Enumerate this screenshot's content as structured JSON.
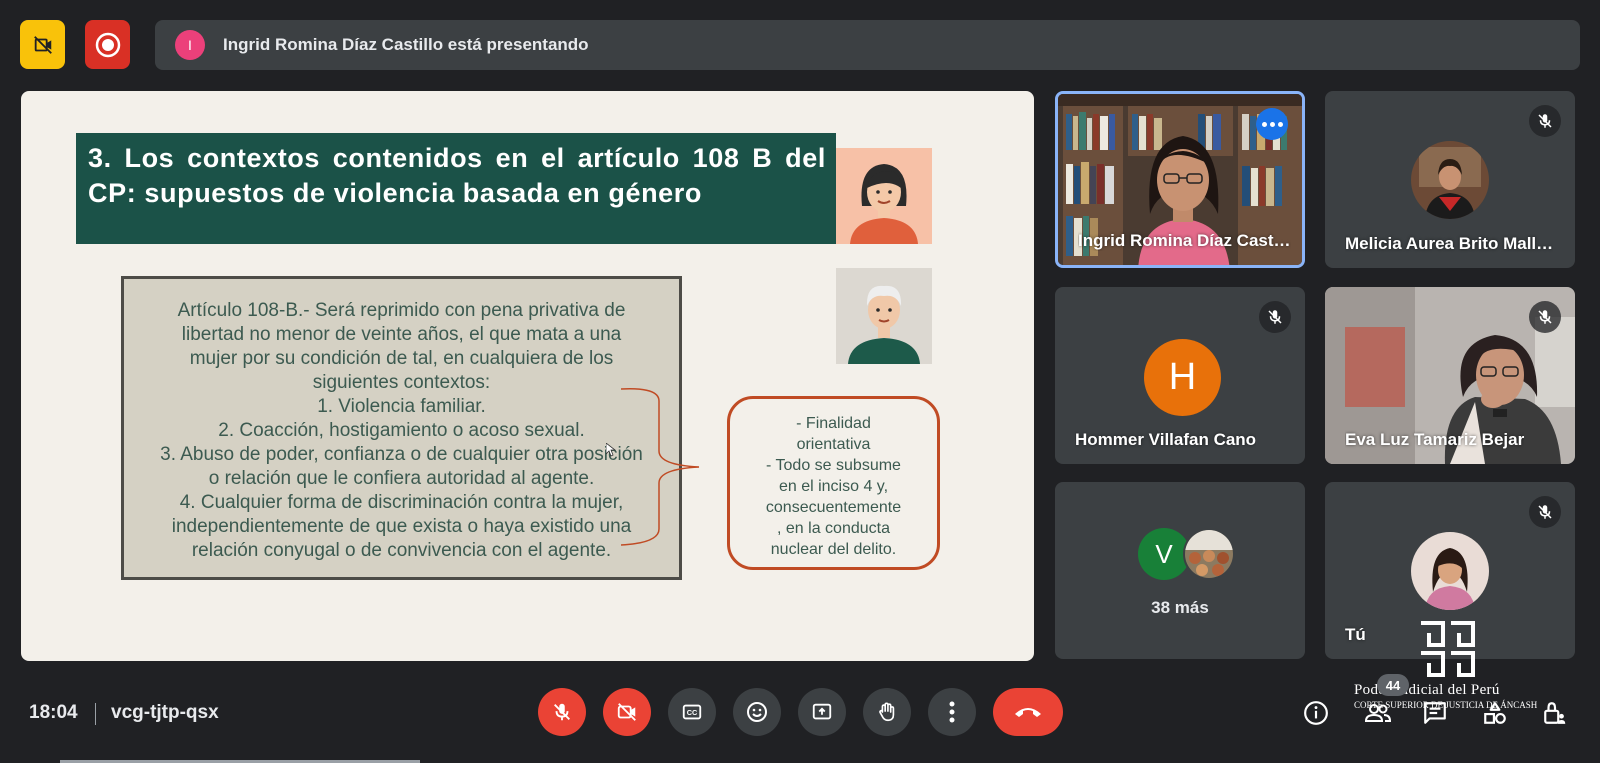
{
  "presenter_banner": {
    "initial": "I",
    "text": "Ingrid Romina Díaz Castillo está presentando"
  },
  "slide": {
    "title": "3. Los contextos contenidos en el artículo 108 B del CP: supuestos de violencia basada en género",
    "article_lines": [
      "Artículo 108-B.- Será reprimido con pena privativa de",
      "libertad no menor de veinte años, el que mata a una",
      "mujer por su condición de tal, en cualquiera de los",
      "siguientes contextos:",
      "1. Violencia familiar.",
      "2. Coacción, hostigamiento o acoso sexual.",
      "3. Abuso de poder, confianza o de cualquier otra posición",
      "o relación que le confiera autoridad al agente.",
      "4. Cualquier forma de discriminación contra la mujer,",
      "independientemente de que exista o haya existido una",
      "relación conyugal o de convivencia con el agente."
    ],
    "note_lines": [
      "-   Finalidad",
      "orientativa",
      "-   Todo se subsume",
      "en el inciso 4 y,",
      "consecuentemente",
      ", en la conducta",
      "nuclear del delito."
    ]
  },
  "participants": [
    {
      "name": "Ingrid Romina Díaz Castillo",
      "display": "Ingrid Romina Díaz Cast…",
      "speaking": true
    },
    {
      "name": "Melicia Aurea Brito Mall…",
      "muted": true
    },
    {
      "name": "Hommer Villafan Cano",
      "initial": "H",
      "muted": true,
      "color": "#e8710a"
    },
    {
      "name": "Eva Luz Tamariz Bejar",
      "muted": true
    },
    {
      "initial": "V",
      "more_label": "38 más",
      "color": "#188038"
    },
    {
      "name": "Tú",
      "muted": true
    }
  ],
  "bottom_bar": {
    "time": "18:04",
    "meeting_code": "vcg-tjtp-qsx",
    "participant_count": "44"
  },
  "watermark": {
    "title": "Poder Judicial del Perú",
    "subtitle": "CORTE SUPERIOR DE JUSTICIA DE ÁNCASH"
  },
  "colors": {
    "accent_red": "#ea4335",
    "slide_title_bg": "#1b5248",
    "active_speaker_border": "#8ab4f8"
  }
}
